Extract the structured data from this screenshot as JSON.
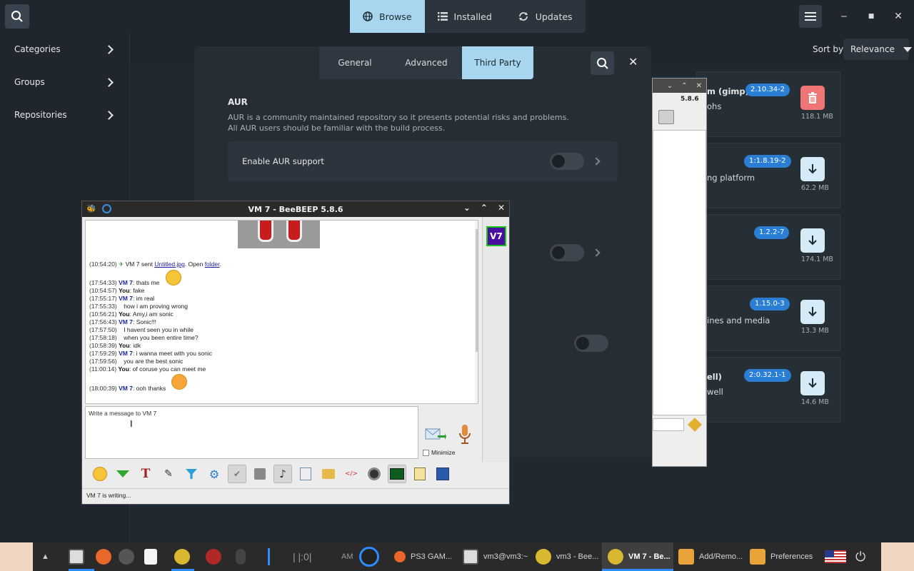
{
  "topbar": {
    "tabs": [
      {
        "label": "Browse",
        "icon": "globe-icon"
      },
      {
        "label": "Installed",
        "icon": "list-icon"
      },
      {
        "label": "Updates",
        "icon": "refresh-icon"
      }
    ]
  },
  "sidebar": {
    "items": [
      {
        "label": "Categories"
      },
      {
        "label": "Groups"
      },
      {
        "label": "Repositories"
      }
    ]
  },
  "sort": {
    "label": "Sort by",
    "value": "Relevance"
  },
  "cards": [
    {
      "title": "m (gimp)",
      "desc": "ohs",
      "version": "2.10.34-2",
      "size": "118.1 MB",
      "action": "trash-icon"
    },
    {
      "title": "",
      "desc": "ng platform",
      "version": "1:1.8.19-2",
      "size": "62.2 MB",
      "action": "download-icon"
    },
    {
      "title": "",
      "desc": "",
      "version": "1.2.2-7",
      "size": "174.1 MB",
      "action": "download-icon"
    },
    {
      "title": "",
      "desc": "ines and media",
      "version": "1.15.0-3",
      "size": "13.3 MB",
      "action": "download-icon"
    },
    {
      "title": "ell)",
      "desc": "well",
      "version": "2:0.32.1-1",
      "size": "14.6 MB",
      "action": "download-icon"
    }
  ],
  "prefs": {
    "tabs": [
      "General",
      "Advanced",
      "Third Party"
    ],
    "active_tab": "Third Party",
    "aur_heading": "AUR",
    "aur_desc_1": "AUR is a community maintained repository so it presents potential risks and problems.",
    "aur_desc_2": "All AUR users should be familiar with the build process.",
    "enable_aur_label": "Enable AUR support"
  },
  "bgwin": {
    "version": "5.8.6"
  },
  "beebeep": {
    "title": "VM 7 - BeeBEEP 5.8.6",
    "avatar": "V7",
    "chat": [
      {
        "ts": "(10:54:20)",
        "who": "",
        "text": "VM 7 sent ",
        "link1": "Untitled.jpg",
        "mid": ". Open ",
        "link2": "folder",
        "end": "."
      },
      {
        "ts": "(17:54:33)",
        "who": "VM 7",
        "text": ": thats me"
      },
      {
        "ts": "(10:54:57)",
        "who": "You",
        "text": ": fake"
      },
      {
        "ts": "(17:55:17)",
        "who": "VM 7",
        "text": ": im real"
      },
      {
        "ts": "(17:55:33)",
        "who": "",
        "text": "how i am proving wrong"
      },
      {
        "ts": "(10:56:21)",
        "who": "You",
        "text": ": Amy,i am sonic"
      },
      {
        "ts": "(17:56:43)",
        "who": "VM 7",
        "text": ": Sonic!!!"
      },
      {
        "ts": "(17:57:50)",
        "who": "",
        "text": "I havent seen you in while"
      },
      {
        "ts": "(17:58:18)",
        "who": "",
        "text": "when you been entire time?"
      },
      {
        "ts": "(10:58:39)",
        "who": "You",
        "text": ": idk"
      },
      {
        "ts": "(17:59:29)",
        "who": "VM 7",
        "text": ": i wanna meet with you sonic"
      },
      {
        "ts": "(17:59:56)",
        "who": "",
        "text": "you are the best sonic"
      },
      {
        "ts": "(11:00:14)",
        "who": "You",
        "text": ": of coruse you can meet me"
      },
      {
        "ts": "(18:00:39)",
        "who": "VM 7",
        "text": ": ooh thanks"
      }
    ],
    "input_placeholder": "Write a message to VM 7",
    "minimize_label": "Minimize",
    "status": "VM 7 is writing..."
  },
  "taskbar": {
    "clock": "AM",
    "items": [
      {
        "label": "PS3 GAM..."
      },
      {
        "label": "vm3@vm3:~"
      },
      {
        "label": "vm3 - Bee..."
      },
      {
        "label": "VM 7 - Be..."
      },
      {
        "label": "Add/Remo..."
      },
      {
        "label": "Preferences"
      }
    ]
  },
  "colors": {
    "accent": "#a9d6ef",
    "badge": "#2a7fd4",
    "delete": "#f07575"
  }
}
